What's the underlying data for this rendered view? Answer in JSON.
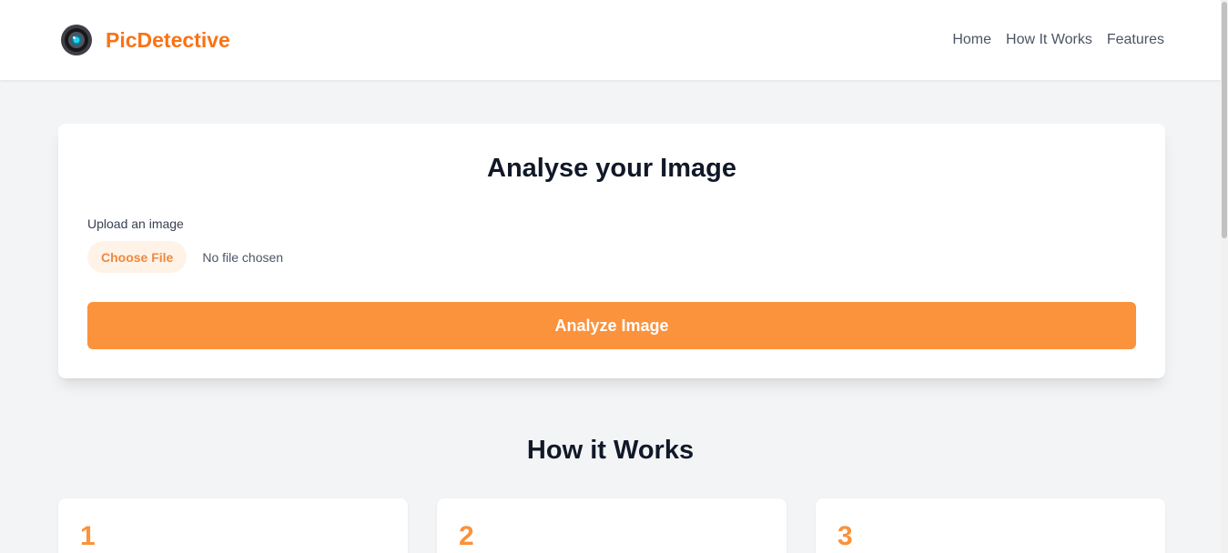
{
  "header": {
    "brand": "PicDetective",
    "logo_icon": "camera-lens-icon",
    "nav": [
      "Home",
      "How It Works",
      "Features"
    ]
  },
  "upload": {
    "title": "Analyse your Image",
    "label": "Upload an image",
    "choose_file": "Choose File",
    "no_file": "No file chosen",
    "analyze": "Analyze Image"
  },
  "how_it_works": {
    "title": "How it Works",
    "steps": [
      "1",
      "2",
      "3"
    ]
  },
  "colors": {
    "brand": "#f97316",
    "accent": "#fb923c",
    "background": "#f3f4f6"
  }
}
